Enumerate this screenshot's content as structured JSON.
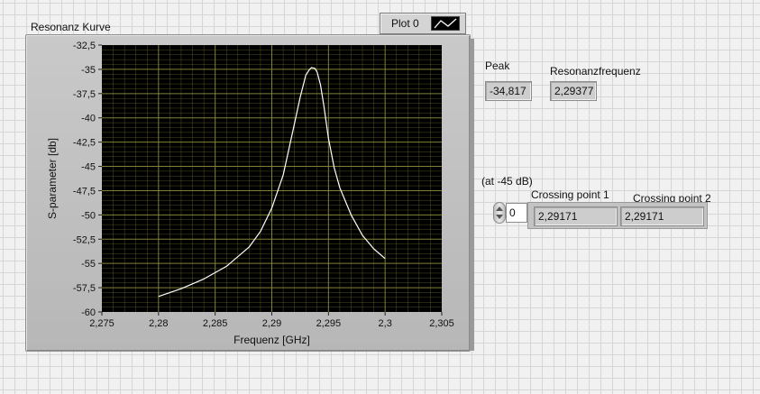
{
  "graph": {
    "title": "Resonanz Kurve",
    "legend_label": "Plot 0",
    "xlabel": "Frequenz [GHz]",
    "ylabel": "S-parameter [db]",
    "background": "#000000",
    "grid_color": "#8f8f3c",
    "line_color": "#ffffff"
  },
  "chart_data": {
    "type": "line",
    "title": "Resonanz Kurve",
    "xlabel": "Frequenz [GHz]",
    "ylabel": "S-parameter [db]",
    "xlim": [
      2.275,
      2.305
    ],
    "ylim": [
      -60,
      -32.5
    ],
    "x_ticks": [
      "2,275",
      "2,28",
      "2,285",
      "2,29",
      "2,295",
      "2,3",
      "2,305"
    ],
    "y_ticks": [
      "-32,5",
      "-35",
      "-37,5",
      "-40",
      "-42,5",
      "-45",
      "-47,5",
      "-50",
      "-52,5",
      "-55",
      "-57,5",
      "-60"
    ],
    "grid": true,
    "legend": "top-right",
    "series": [
      {
        "name": "Plot 0",
        "x": [
          2.28,
          2.282,
          2.284,
          2.286,
          2.288,
          2.289,
          2.29,
          2.291,
          2.292,
          2.2925,
          2.293,
          2.2933,
          2.2935,
          2.2938,
          2.294,
          2.2943,
          2.2946,
          2.295,
          2.2955,
          2.296,
          2.297,
          2.298,
          2.299,
          2.3
        ],
        "y": [
          -58.4,
          -57.6,
          -56.6,
          -55.3,
          -53.3,
          -51.7,
          -49.3,
          -45.9,
          -40.6,
          -37.9,
          -35.6,
          -35.05,
          -34.82,
          -34.9,
          -35.3,
          -36.6,
          -38.8,
          -42.1,
          -45.1,
          -47.2,
          -50.0,
          -52.1,
          -53.5,
          -54.5
        ]
      }
    ]
  },
  "indicators": {
    "peak_label": "Peak",
    "peak_value": "-34,817",
    "resfreq_label": "Resonanzfrequenz",
    "resfreq_value": "2,29377",
    "threshold_label": "(at -45 dB)",
    "index_value": "0",
    "cross1_label": "Crossing point 1",
    "cross1_value": "2,29171",
    "cross2_label": "Crossing point 2",
    "cross2_value": "2,29171"
  }
}
